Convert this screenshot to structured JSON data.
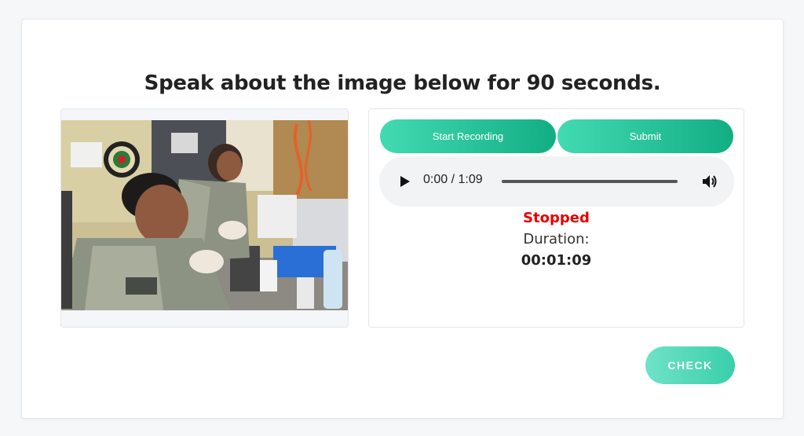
{
  "page": {
    "title": "Speak about the image below for 90 seconds."
  },
  "image": {
    "alt": "Two soldiers in camouflage uniforms working at a lab bench"
  },
  "recorder": {
    "start_label": "Start Recording",
    "submit_label": "Submit",
    "player": {
      "time": "0:00 / 1:09",
      "play_icon": "play-icon",
      "volume_icon": "volume-icon"
    },
    "status": "Stopped",
    "duration_label": "Duration:",
    "duration_value": "00:01:09"
  },
  "actions": {
    "check_label": "CHECK"
  },
  "colors": {
    "accent_start": "#43dab2",
    "accent_end": "#12ae83",
    "status_stopped": "#e60000"
  }
}
